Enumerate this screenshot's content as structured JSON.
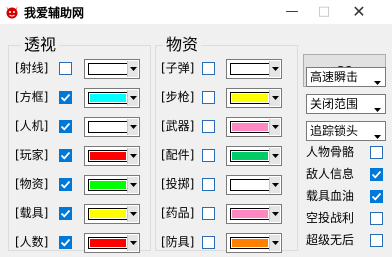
{
  "window": {
    "title": "我爱辅助网",
    "minimize_glyph": "—",
    "maximize_glyph": "□",
    "close_glyph": "✕"
  },
  "perspective": {
    "title": "透视",
    "rows": [
      {
        "label": "[射线]",
        "checked": false,
        "color": "#ffffff"
      },
      {
        "label": "[方框]",
        "checked": true,
        "color": "#00ffff"
      },
      {
        "label": "[人机]",
        "checked": true,
        "color": "#ffffff"
      },
      {
        "label": "[玩家]",
        "checked": true,
        "color": "#ff0000"
      },
      {
        "label": "[物资]",
        "checked": true,
        "color": "#00ff00"
      },
      {
        "label": "[载具]",
        "checked": true,
        "color": "#ffff00"
      },
      {
        "label": "[人数]",
        "checked": true,
        "color": "#ff0000"
      }
    ]
  },
  "supplies": {
    "title": "物资",
    "rows": [
      {
        "label": "[子弹]",
        "checked": false,
        "color": "#ffffff"
      },
      {
        "label": "[步枪]",
        "checked": false,
        "color": "#ffff00"
      },
      {
        "label": "[武器]",
        "checked": false,
        "color": "#ff88c2"
      },
      {
        "label": "[配件]",
        "checked": false,
        "color": "#00cc66"
      },
      {
        "label": "[投掷]",
        "checked": false,
        "color": "#ffffff"
      },
      {
        "label": "[药品]",
        "checked": false,
        "color": "#ff88c2"
      },
      {
        "label": "[防具]",
        "checked": false,
        "color": "#ff8000"
      }
    ]
  },
  "controls": {
    "go_label": "GO",
    "dropdowns": [
      {
        "value": "高速瞬击"
      },
      {
        "value": "关闭范围"
      },
      {
        "value": "追踪锁头"
      }
    ],
    "options": [
      {
        "label": "人物骨骼",
        "checked": false
      },
      {
        "label": "敌人信息",
        "checked": true
      },
      {
        "label": "载具血油",
        "checked": true
      },
      {
        "label": "空投战利",
        "checked": false
      },
      {
        "label": "超级无后",
        "checked": false
      }
    ]
  },
  "icons": {
    "app": "devil-logo-icon",
    "dropdown_arrow": "chevron-down-icon",
    "checkmark": "checkmark-icon"
  },
  "colors": {
    "checkbox_checked": "#0078d7",
    "checkbox_unchecked_border": "#2a6db5",
    "window_background": "#f0f0f0",
    "button_background": "#e1e1e1"
  }
}
